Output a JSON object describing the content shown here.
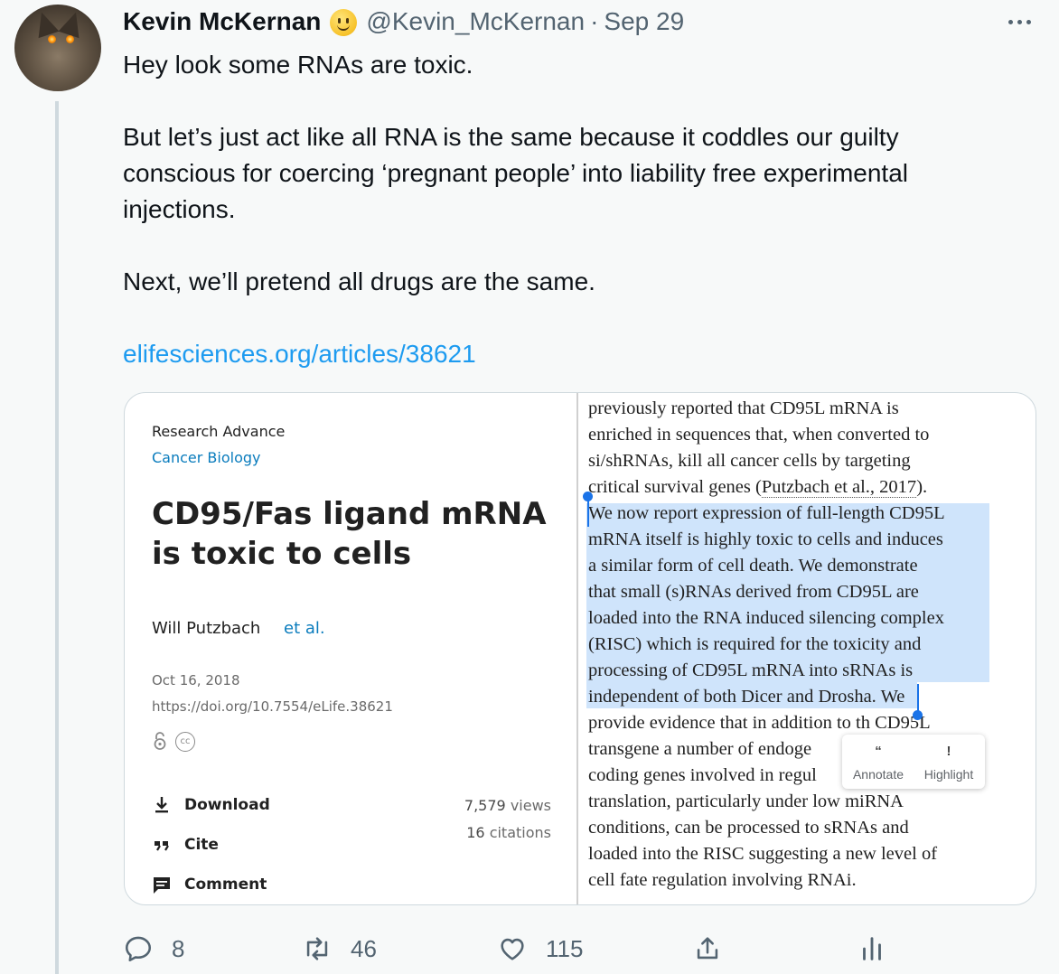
{
  "tweet": {
    "display_name": "Kevin McKernan",
    "handle": "@Kevin_McKernan",
    "separator": "·",
    "date": "Sep 29",
    "text_lines": [
      "Hey look some RNAs are toxic.",
      "But let’s just act like all RNA is the same because it coddles our guilty conscious for coercing ‘pregnant people’ into liability free experimental injections.",
      "Next, we’ll pretend all drugs are the same."
    ],
    "link": "elifesciences.org/articles/38621",
    "icons": {
      "avatar": "cat-avatar",
      "name_emoji": "smiling-face-emoji",
      "more": "more-options-icon"
    }
  },
  "card": {
    "left": {
      "kicker": "Research Advance",
      "subject": "Cancer Biology",
      "title": "CD95/Fas ligand mRNA is toxic to cells",
      "author": "Will Putzbach",
      "et_al": "et al.",
      "date": "Oct 16, 2018",
      "doi": "https://doi.org/10.7554/eLife.38621",
      "actions": [
        {
          "label": "Download",
          "icon": "download-icon"
        },
        {
          "label": "Cite",
          "icon": "quote-icon"
        },
        {
          "label": "Comment",
          "icon": "comment-icon"
        }
      ],
      "views": "7,579",
      "views_label": "views",
      "citations": "16",
      "citations_label": "citations"
    },
    "right": {
      "lines": [
        "previously reported that CD95L mRNA is",
        "enriched in sequences that, when converted to",
        "si/shRNAs, kill all cancer cells by targeting",
        "critical survival genes (",
        "We now report expression of full-length CD95L",
        "mRNA itself is highly toxic to cells and induces",
        "a similar form of cell death. We demonstrate",
        "that small (s)RNAs derived from CD95L are",
        "loaded into the RNA induced silencing complex",
        "(RISC) which is required for the toxicity and",
        "processing of CD95L mRNA into sRNAs is",
        "independent of both Dicer and Drosha.",
        "provide evidence that in addition to th",
        "transgene a number of endoge",
        "coding genes involved in regul",
        "translation, particularly under low miRNA",
        "conditions, can be processed to sRNAs and",
        "loaded into the RISC suggesting a new level of",
        "cell fate regulation involving RNAi."
      ],
      "citation_link": "Putzbach et al., 2017",
      "citation_tail": ").",
      "we_after_selection": "We",
      "cd95l_tail": "CD95L",
      "popup": {
        "annotate": "Annotate",
        "highlight": "Highlight"
      }
    }
  },
  "actions": {
    "replies": "8",
    "retweets": "46",
    "likes": "115"
  },
  "colors": {
    "accent": "#1d9bf0",
    "muted": "#536471",
    "background": "#f7f9f9",
    "highlight": "#cfe4fb",
    "elife_blue": "#0a7cbd"
  }
}
